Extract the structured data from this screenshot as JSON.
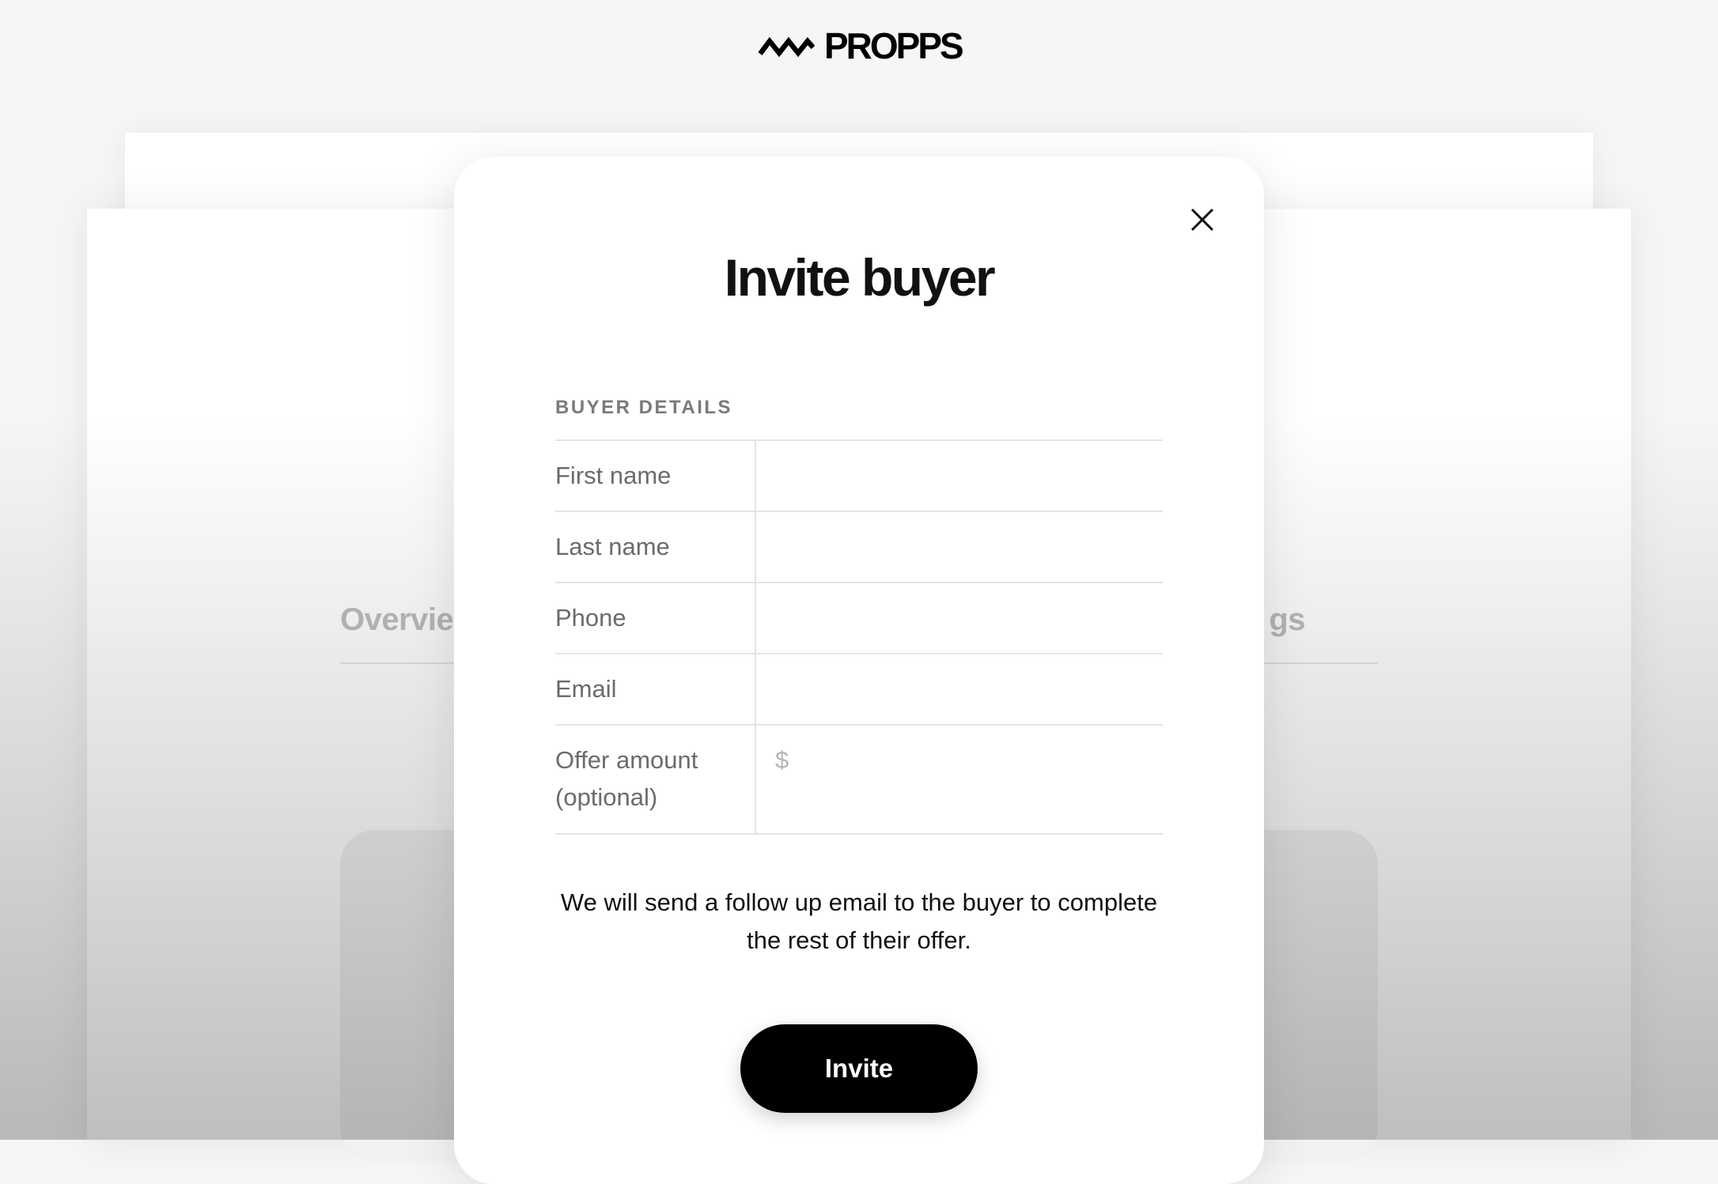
{
  "brand": {
    "name": "PROPPS",
    "logo_icon": "zigzag-wave-icon"
  },
  "background": {
    "tabs": {
      "left_partial": "Overvie",
      "right_partial": "gs"
    }
  },
  "modal": {
    "title": "Invite buyer",
    "close_icon": "close-icon",
    "section_label": "BUYER DETAILS",
    "fields": [
      {
        "label": "First name",
        "value": "",
        "placeholder": ""
      },
      {
        "label": "Last name",
        "value": "",
        "placeholder": ""
      },
      {
        "label": "Phone",
        "value": "",
        "placeholder": ""
      },
      {
        "label": "Email",
        "value": "",
        "placeholder": ""
      },
      {
        "label": "Offer amount\n(optional)",
        "value": "",
        "placeholder": "$"
      }
    ],
    "note": "We will send a follow up email to the buyer to complete the rest of their offer.",
    "invite_label": "Invite"
  },
  "colors": {
    "accent": "#000000",
    "label_text": "#6b6b6b",
    "border": "#e4e4e4"
  }
}
